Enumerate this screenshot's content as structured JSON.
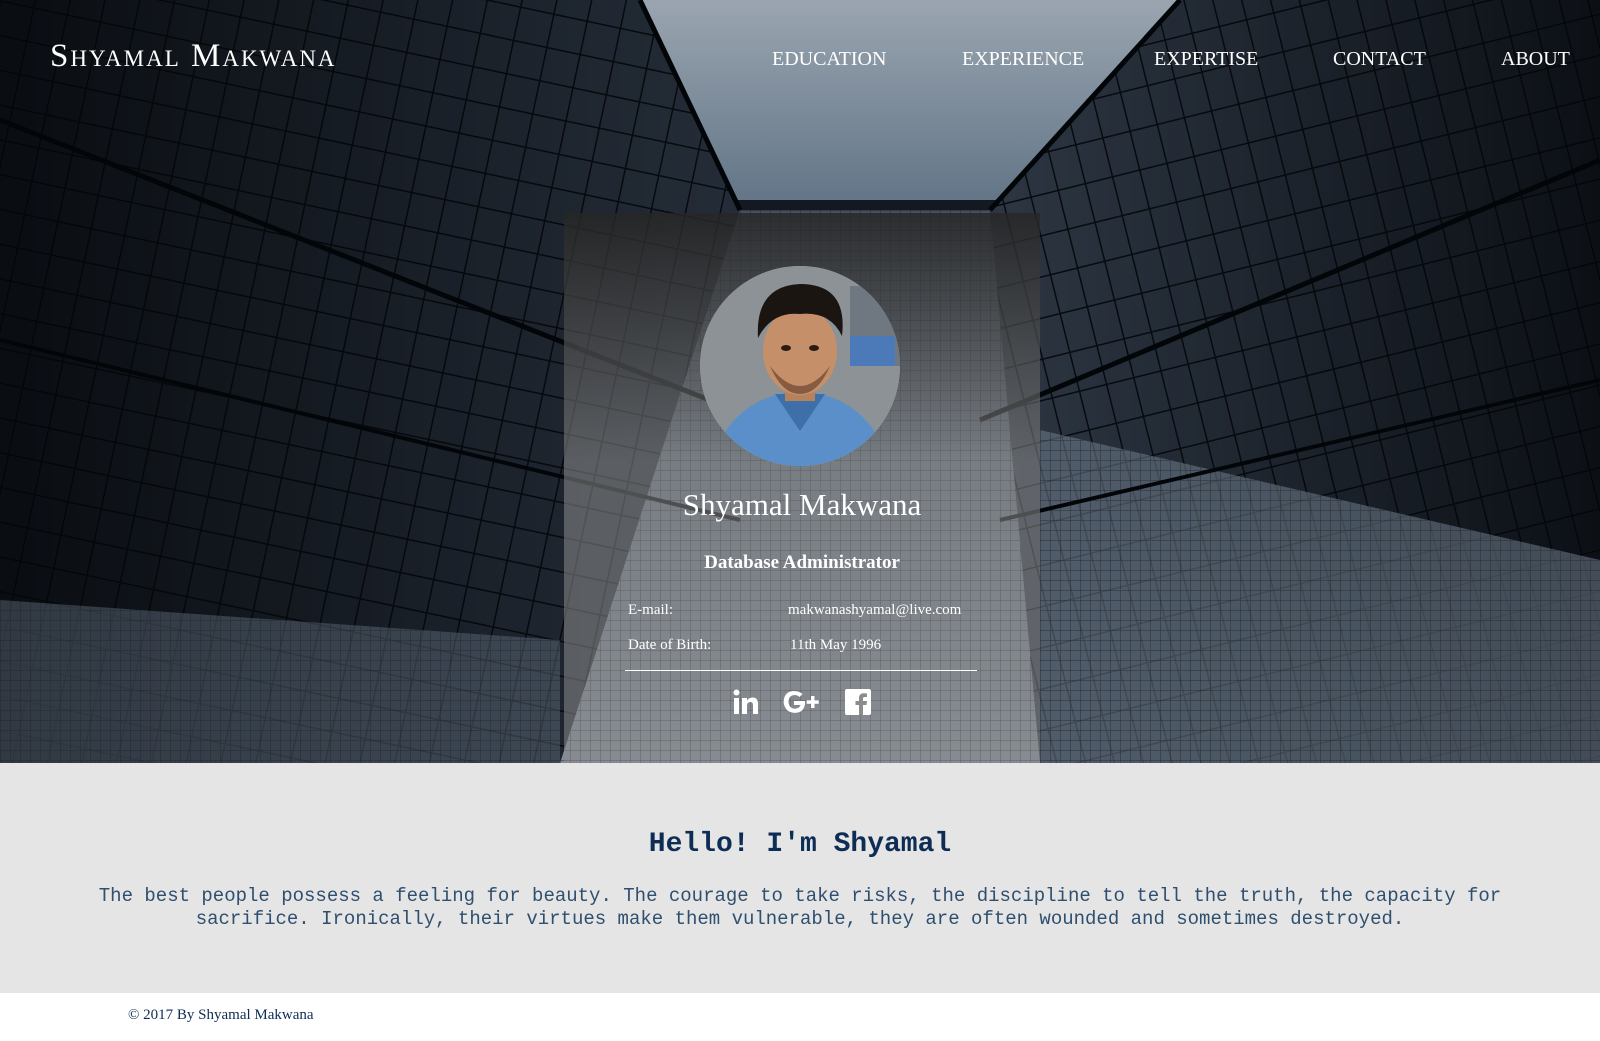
{
  "header": {
    "brand": "Shyamal Makwana",
    "nav": [
      {
        "label": "EDUCATION"
      },
      {
        "label": "EXPERIENCE"
      },
      {
        "label": "EXPERTISE"
      },
      {
        "label": "CONTACT"
      },
      {
        "label": "ABOUT"
      }
    ]
  },
  "profile": {
    "name": "Shyamal Makwana",
    "role": "Database Administrator",
    "email_label": "E-mail:",
    "email_value": "makwanashyamal@live.com",
    "dob_label": "Date of Birth:",
    "dob_value": "11th May 1996",
    "social": [
      "linkedin-icon",
      "google-plus-icon",
      "facebook-icon"
    ]
  },
  "intro": {
    "title": "Hello! I'm Shyamal",
    "text": "The best people possess a feeling for beauty. The courage to take risks, the discipline to tell the truth, the capacity for sacrifice. Ironically, their virtues make them vulnerable, they are often wounded and sometimes destroyed."
  },
  "footer": {
    "copyright": "© 2017 By Shyamal Makwana"
  },
  "colors": {
    "intro_bg": "#e5e5e5",
    "heading": "#0d2d55",
    "body_text": "#2f4f6f",
    "nav_text": "#ffffff"
  }
}
